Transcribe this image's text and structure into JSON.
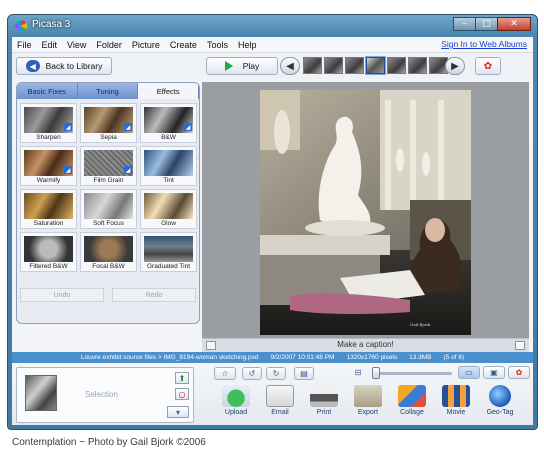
{
  "window": {
    "title": "Picasa 3"
  },
  "menu": [
    "File",
    "Edit",
    "View",
    "Folder",
    "Picture",
    "Create",
    "Tools",
    "Help"
  ],
  "signin_link": "Sign In to Web Albums",
  "toolbar": {
    "back_label": "Back to Library",
    "play_label": "Play",
    "prev_icon": "left-arrow-icon",
    "next_icon": "right-arrow-icon"
  },
  "tabs": [
    "Basic Fixes",
    "Tuning",
    "Effects"
  ],
  "active_tab": "Effects",
  "effects": [
    "Sharpen",
    "Sepia",
    "B&W",
    "Warmify",
    "Film Grain",
    "Tint",
    "Saturation",
    "Soft Focus",
    "Glow",
    "Filtered B&W",
    "Focal B&W",
    "Graduated Tint"
  ],
  "undo_label": "Undo",
  "redo_label": "Redo",
  "caption_placeholder": "Make a caption!",
  "info": {
    "path": "Louvre exhibit source files > IMG_8194-woman sketching.psd",
    "date": "9/2/2007 10:01:48 PM",
    "dimensions": "1320x1760 pixels",
    "size": "13.3MB",
    "position": "(5 of 8)"
  },
  "tray": {
    "label": "Selection"
  },
  "actions": [
    "Upload",
    "Email",
    "Print",
    "Export",
    "Collage",
    "Movie",
    "Geo-Tag"
  ],
  "photo_signature": "Gail Bjork",
  "footer_caption": "Contemplation ~ Photo by Gail Bjork ©2006"
}
